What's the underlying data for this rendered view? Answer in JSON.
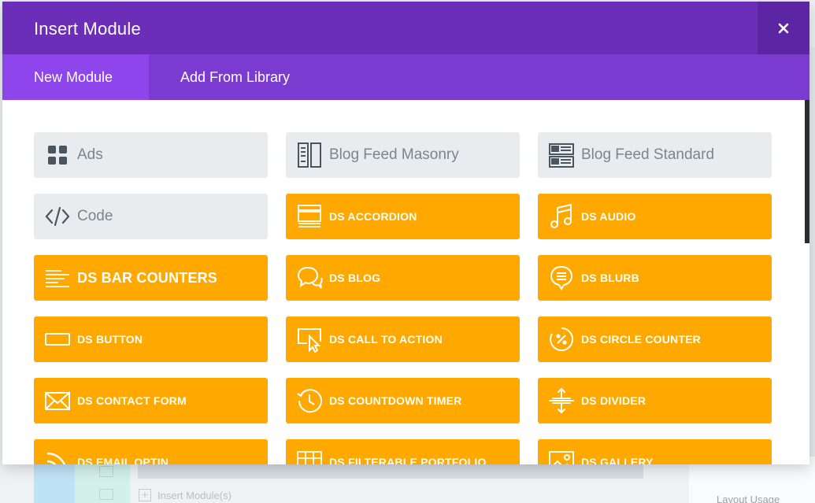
{
  "modal": {
    "title": "Insert Module",
    "close_label": "×"
  },
  "tabs": [
    {
      "label": "New Module",
      "active": true
    },
    {
      "label": "Add From Library",
      "active": false
    }
  ],
  "modules": [
    {
      "label": "Ads",
      "style": "grey",
      "icon": "grid-icon"
    },
    {
      "label": "Blog Feed Masonry",
      "style": "grey",
      "icon": "masonry-icon"
    },
    {
      "label": "Blog Feed Standard",
      "style": "grey",
      "icon": "list-feed-icon"
    },
    {
      "label": "Code",
      "style": "grey",
      "icon": "code-icon"
    },
    {
      "label": "DS ACCORDION",
      "style": "orange",
      "icon": "accordion-icon"
    },
    {
      "label": "DS AUDIO",
      "style": "orange",
      "icon": "music-note-icon"
    },
    {
      "label": "DS BAR COUNTERS",
      "style": "orange",
      "icon": "bar-lines-icon"
    },
    {
      "label": "DS BLOG",
      "style": "orange",
      "icon": "chat-bubbles-icon"
    },
    {
      "label": "DS BLURB",
      "style": "orange",
      "icon": "blurb-pin-icon"
    },
    {
      "label": "DS BUTTON",
      "style": "orange",
      "icon": "button-rect-icon"
    },
    {
      "label": "DS CALL TO ACTION",
      "style": "orange",
      "icon": "cursor-screen-icon"
    },
    {
      "label": "DS CIRCLE COUNTER",
      "style": "orange",
      "icon": "circle-percent-icon"
    },
    {
      "label": "DS CONTACT FORM",
      "style": "orange",
      "icon": "envelope-icon"
    },
    {
      "label": "DS COUNTDOWN TIMER",
      "style": "orange",
      "icon": "clock-icon"
    },
    {
      "label": "DS DIVIDER",
      "style": "orange",
      "icon": "divider-arrows-icon"
    },
    {
      "label": "DS EMAIL OPTIN",
      "style": "orange",
      "icon": "rss-icon"
    },
    {
      "label": "DS FILTERABLE PORTFOLIO",
      "style": "orange",
      "icon": "portfolio-grid-icon"
    },
    {
      "label": "DS GALLERY",
      "style": "orange",
      "icon": "image-icon"
    }
  ],
  "background": {
    "insert_label": "Insert Module(s)",
    "right_panel_label": "Layout Usage"
  },
  "colors": {
    "header": "#6c2eb9",
    "tabs_bar": "#7b3bd1",
    "tab_active": "#8e46ec",
    "module_orange": "#ffa800",
    "module_grey": "#e8ecef"
  }
}
